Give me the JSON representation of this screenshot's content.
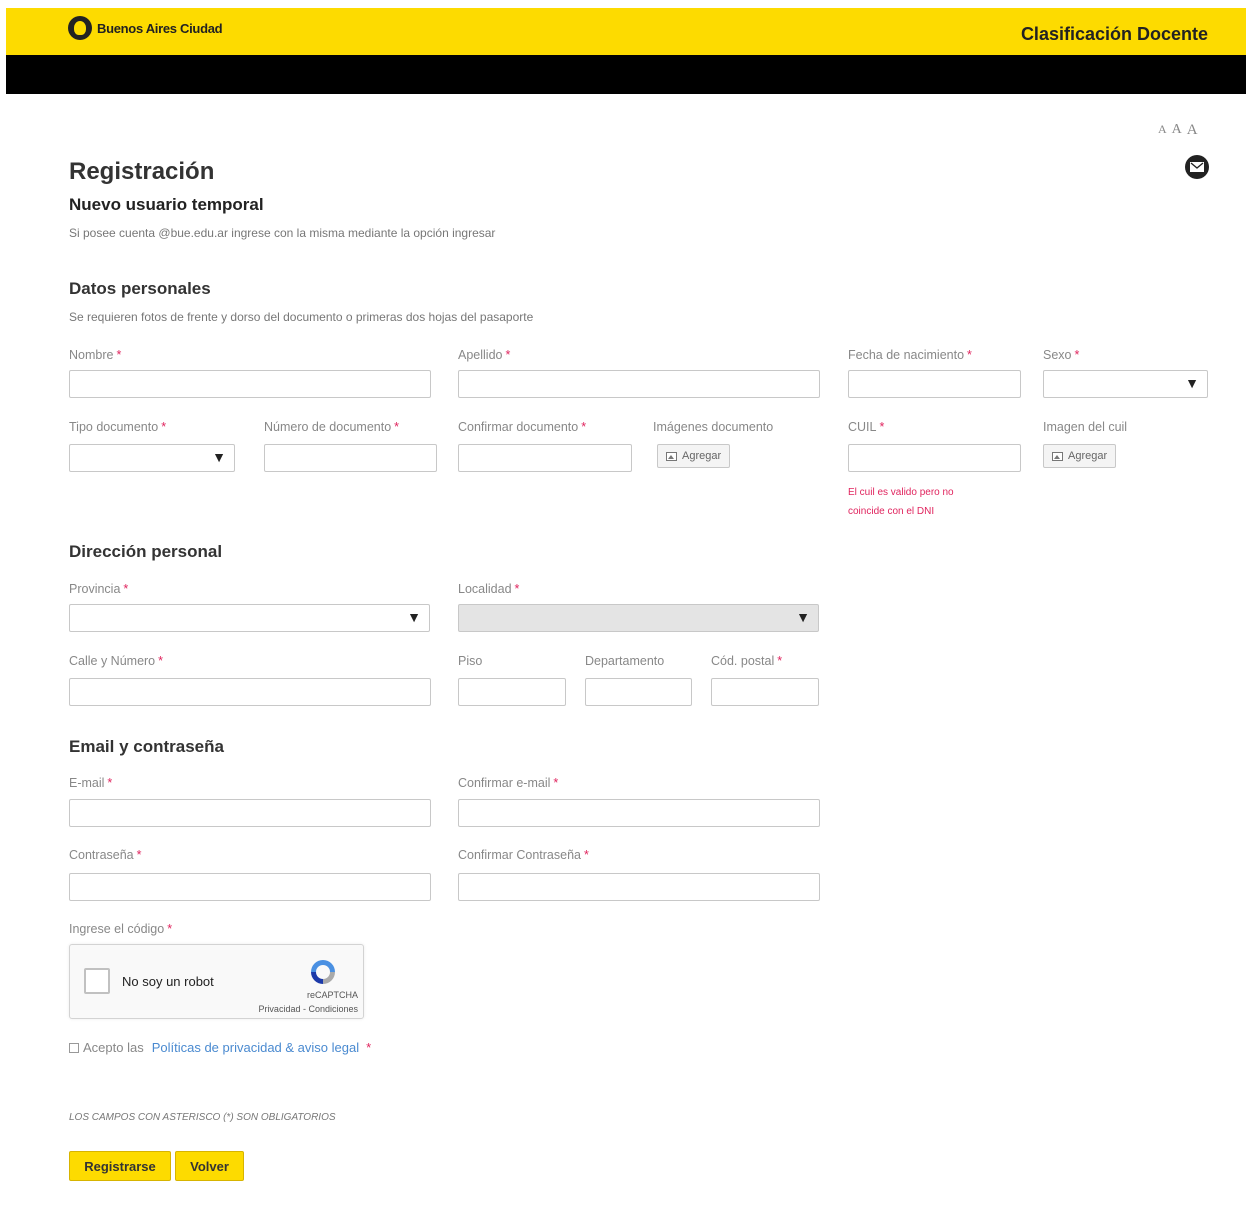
{
  "header": {
    "brand": "Buenos Aires Ciudad",
    "title": "Clasificación Docente"
  },
  "font_controls": [
    "A",
    "A",
    "A"
  ],
  "page": {
    "title": "Registración",
    "subtitle": "Nuevo usuario temporal",
    "note": "Si posee cuenta @bue.edu.ar ingrese con la misma mediante la opción ingresar"
  },
  "personal": {
    "heading": "Datos personales",
    "note": "Se requieren fotos de frente y dorso del documento o primeras dos hojas del pasaporte",
    "nombre": "Nombre",
    "apellido": "Apellido",
    "fecha_nacimiento": "Fecha de nacimiento",
    "sexo": "Sexo",
    "tipo_documento": "Tipo documento",
    "numero_documento": "Número de documento",
    "confirmar_documento": "Confirmar documento",
    "imagenes_documento": "Imágenes documento",
    "cuil": "CUIL",
    "imagen_cuil": "Imagen del cuil",
    "agregar": "Agregar",
    "cuil_hint_1": "El cuil es valido pero no",
    "cuil_hint_2": "coincide con el DNI"
  },
  "address": {
    "heading": "Dirección personal",
    "provincia": "Provincia",
    "localidad": "Localidad",
    "calle": "Calle y Número",
    "piso": "Piso",
    "departamento": "Departamento",
    "cod_postal": "Cód. postal"
  },
  "account": {
    "heading": "Email y contraseña",
    "email": "E-mail",
    "confirmar_email": "Confirmar e-mail",
    "contrasena": "Contraseña",
    "confirmar_contrasena": "Confirmar Contraseña",
    "codigo": "Ingrese el código"
  },
  "captcha": {
    "label": "No soy un robot",
    "brand": "reCAPTCHA",
    "links": "Privacidad - Condiciones"
  },
  "terms": {
    "prefix": "Acepto las",
    "link": "Políticas de privacidad & aviso legal"
  },
  "required_symbol": "*",
  "mandatory_note": "LOS CAMPOS CON ASTERISCO (*) SON OBLIGATORIOS",
  "buttons": {
    "register": "Registrarse",
    "back": "Volver"
  },
  "colors": {
    "brand_yellow": "#fddb00",
    "header_black": "#000000",
    "required_red": "#e0245e",
    "link_blue": "#4a8ad0"
  }
}
